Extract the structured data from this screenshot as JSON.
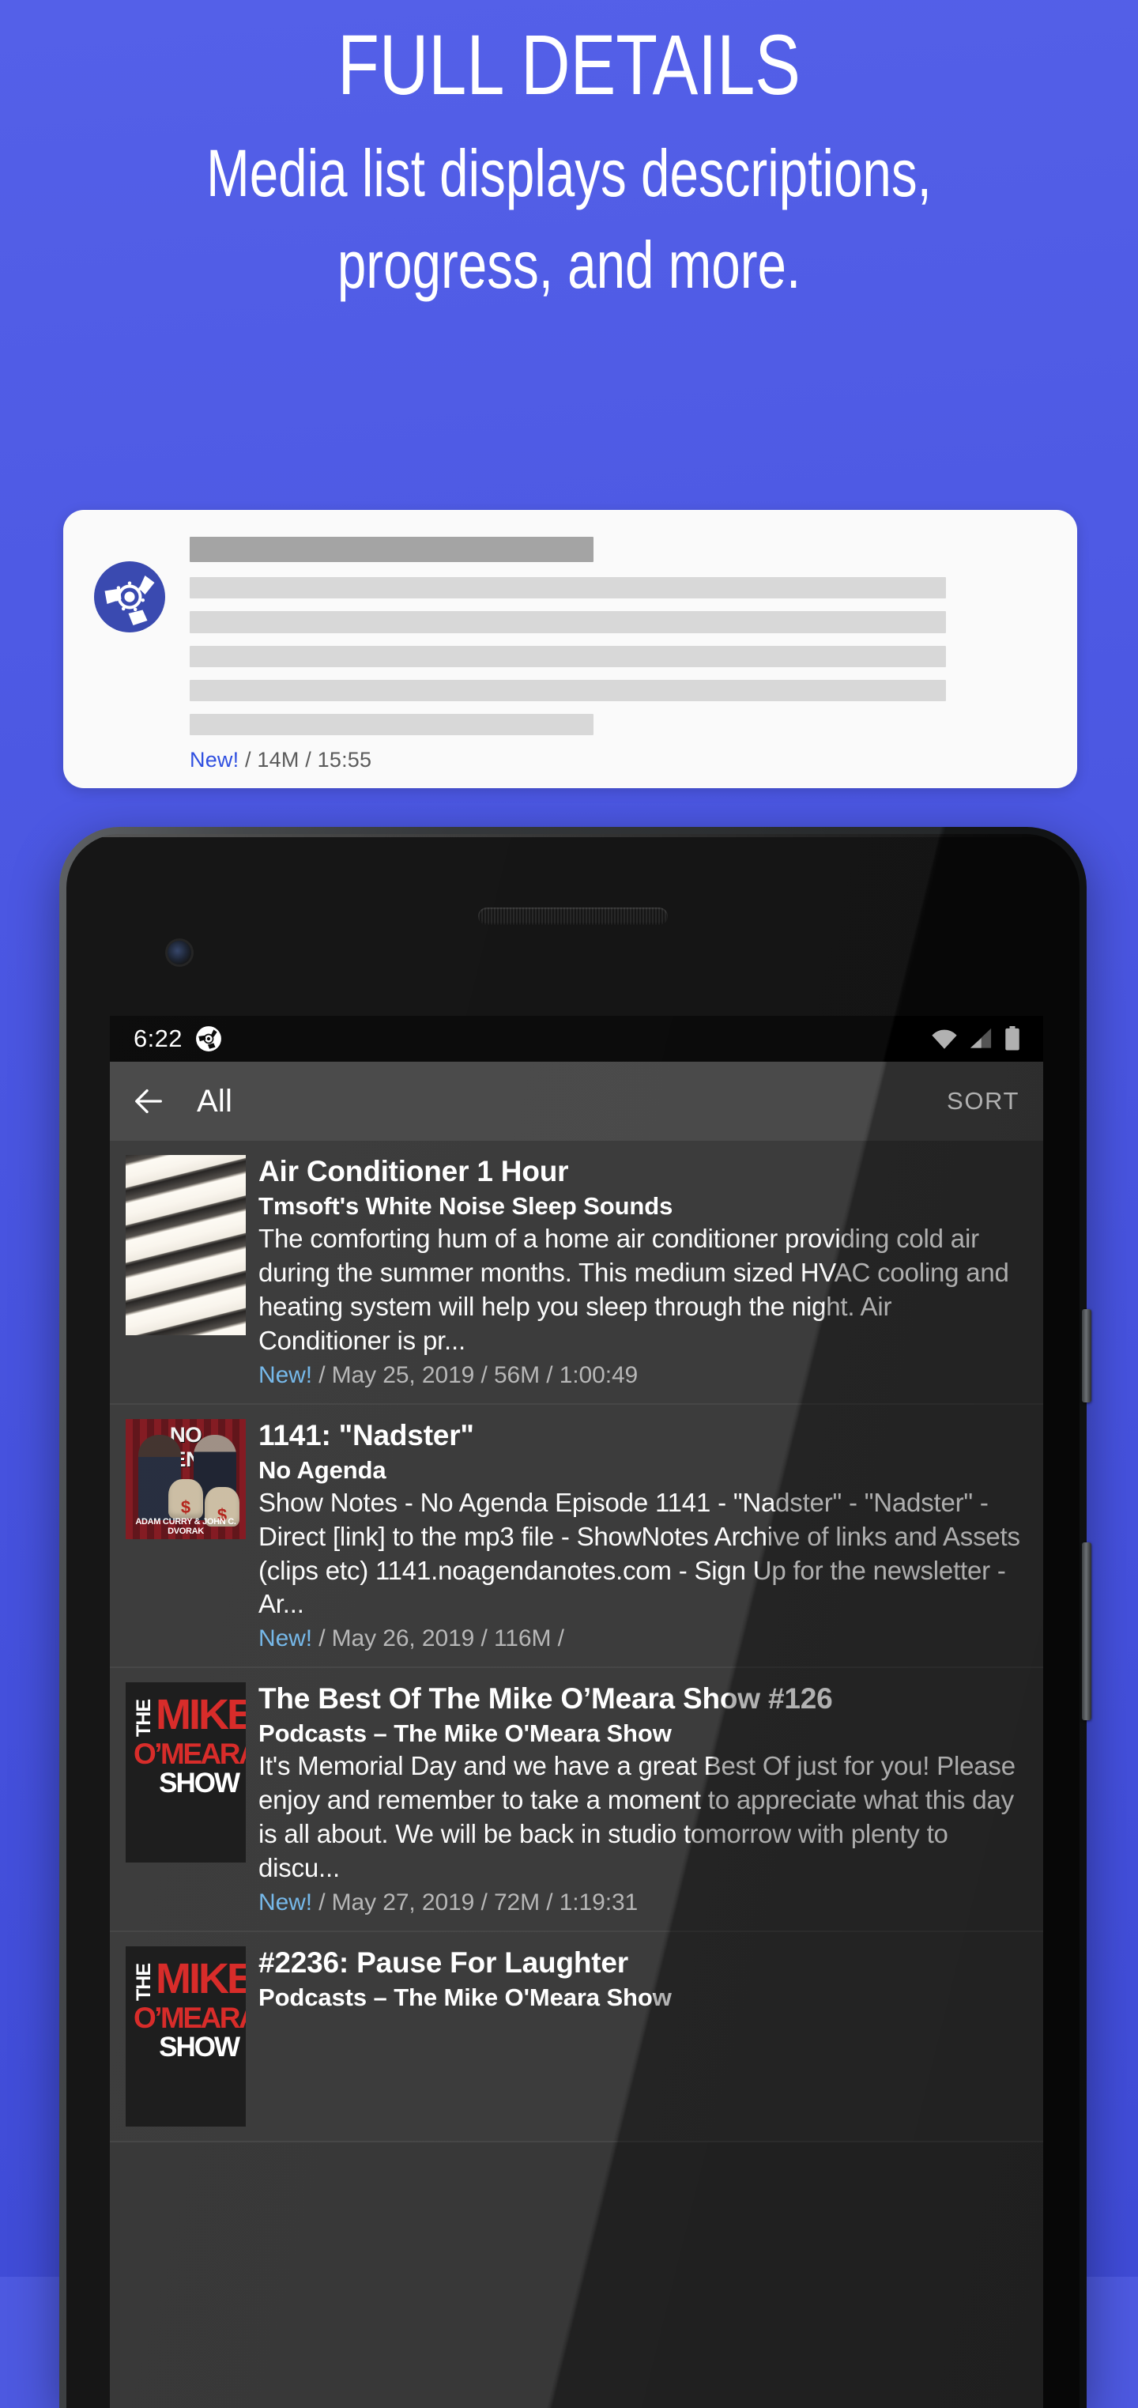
{
  "promo": {
    "title": "FULL DETAILS",
    "subtitle": "Media list displays descriptions, progress, and more.",
    "accent_color": "#4d59e0",
    "card": {
      "art_icon": "reel-disc-icon",
      "meta_new": "New!",
      "meta_rest": " / 14M / 15:55"
    }
  },
  "phone": {
    "status_bar": {
      "time": "6:22",
      "notification_icon": "reel-disc-icon",
      "wifi_icon": "wifi-icon",
      "signal_icon": "cell-signal-icon",
      "battery_icon": "battery-icon"
    },
    "app_bar": {
      "back_icon": "back-arrow-icon",
      "title": "All",
      "sort_label": "SORT"
    },
    "media_items": [
      {
        "art": "air-conditioner-photo",
        "art_shape": "tall",
        "title": "Air Conditioner 1 Hour",
        "subtitle": "Tmsoft's White Noise Sleep Sounds",
        "description": "The comforting hum of a home air conditioner providing cold air during the summer months. This medium sized HVAC cooling and heating system will help you sleep through the night. Air Conditioner is pr...",
        "meta_new": "New!",
        "meta_rest": " / May 25, 2019 / 56M / 1:00:49"
      },
      {
        "art": "no-agenda-cover",
        "art_shape": "square",
        "art_text_top": "NO AGENDA",
        "art_text_bottom": "ADAM CURRY & JOHN C. DVORAK",
        "art_bag_label": "$",
        "title": "1141: \"Nadster\"",
        "subtitle": "No Agenda",
        "description": "Show Notes - No Agenda Episode 1141 - \"Nadster\" - \"Nadster\" - Direct [link] to the mp3 file - ShowNotes Archive of links and Assets (clips etc) 1141.noagendanotes.com - Sign Up for the newsletter - Ar...",
        "meta_new": "New!",
        "meta_rest": " / May 26, 2019 / 116M / "
      },
      {
        "art": "mike-omeara-cover",
        "art_shape": "tall",
        "art_text_the": "THE",
        "art_text_mike": "MIKE",
        "art_text_omeara": "O’MEARA",
        "art_text_show": "SHOW",
        "title": "The Best Of The Mike O’Meara Show #126",
        "subtitle": "Podcasts – The Mike O'Meara Show",
        "description": "It's Memorial Day and we have a great Best Of just for you! Please enjoy and remember to take a moment to appreciate what this day is all about. We will be back in studio tomorrow with plenty to discu...",
        "meta_new": "New!",
        "meta_rest": " / May 27, 2019 / 72M / 1:19:31"
      },
      {
        "art": "mike-omeara-cover",
        "art_shape": "tall",
        "art_text_the": "THE",
        "art_text_mike": "MIKE",
        "art_text_omeara": "O’MEARA",
        "art_text_show": "SHOW",
        "title": "#2236: Pause For Laughter",
        "subtitle": "Podcasts – The Mike O'Meara Show",
        "description": "",
        "meta_new": "",
        "meta_rest": ""
      }
    ]
  }
}
